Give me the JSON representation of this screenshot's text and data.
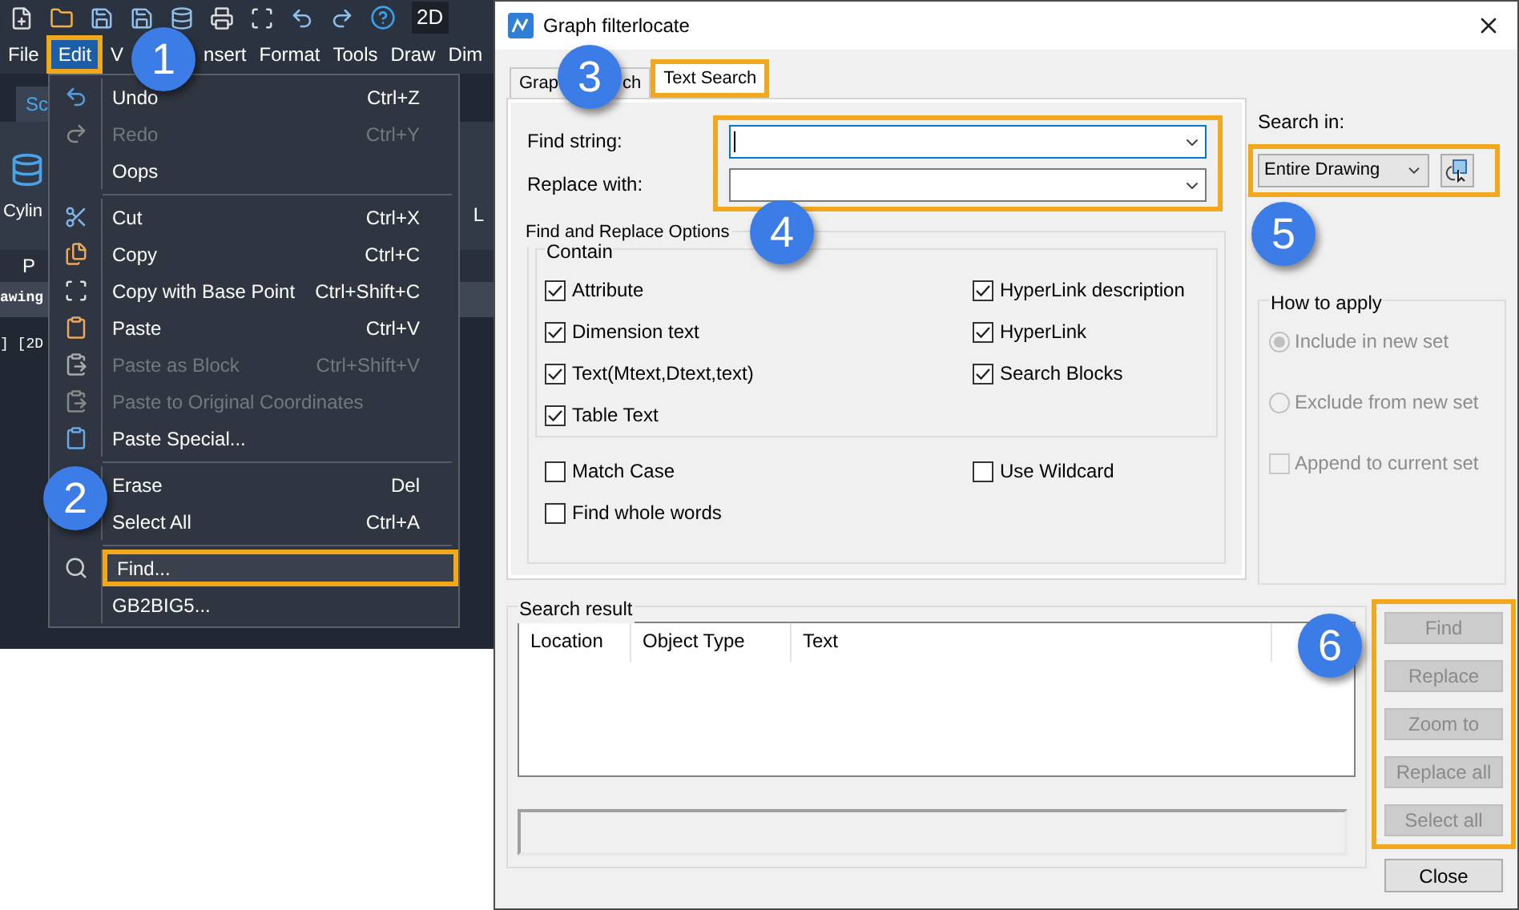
{
  "app": {
    "toolbar_label": "2D",
    "menu": [
      {
        "label": "File",
        "selected": false
      },
      {
        "label": "Edit",
        "selected": true
      },
      {
        "label": "V",
        "selected": false,
        "callout": "1"
      },
      {
        "label": "nsert",
        "selected": false
      },
      {
        "label": "Format",
        "selected": false
      },
      {
        "label": "Tools",
        "selected": false
      },
      {
        "label": "Draw",
        "selected": false
      },
      {
        "label": "Dim",
        "selected": false
      }
    ],
    "ribbon_tab": "Sc",
    "ribbon_button": "Cylin",
    "ribbon_tail": "L",
    "panel_label": "P",
    "drawing_tab": "awing",
    "viewport_label": "] [2D"
  },
  "edit_menu": [
    {
      "kind": "item",
      "label": "Undo",
      "shortcut": "Ctrl+Z",
      "disabled": false,
      "highlighted": false
    },
    {
      "kind": "item",
      "label": "Redo",
      "shortcut": "Ctrl+Y",
      "disabled": true,
      "highlighted": false
    },
    {
      "kind": "item",
      "label": "Oops",
      "disabled": false,
      "highlighted": false
    },
    {
      "kind": "separator"
    },
    {
      "kind": "item",
      "label": "Cut",
      "shortcut": "Ctrl+X",
      "disabled": false,
      "highlighted": false
    },
    {
      "kind": "item",
      "label": "Copy",
      "shortcut": "Ctrl+C",
      "disabled": false,
      "highlighted": false
    },
    {
      "kind": "item",
      "label": "Copy with Base Point",
      "shortcut": "Ctrl+Shift+C",
      "disabled": false,
      "highlighted": false
    },
    {
      "kind": "item",
      "label": "Paste",
      "shortcut": "Ctrl+V",
      "disabled": false,
      "highlighted": false
    },
    {
      "kind": "item",
      "label": "Paste as Block",
      "shortcut": "Ctrl+Shift+V",
      "disabled": true,
      "highlighted": false
    },
    {
      "kind": "item",
      "label": "Paste to Original Coordinates",
      "disabled": true,
      "highlighted": false
    },
    {
      "kind": "item",
      "label": "Paste Special...",
      "disabled": false,
      "highlighted": false
    },
    {
      "kind": "separator"
    },
    {
      "kind": "item",
      "label": "Erase",
      "shortcut": "Del",
      "disabled": false,
      "highlighted": false,
      "callout": "2"
    },
    {
      "kind": "item",
      "label": "Select All",
      "shortcut": "Ctrl+A",
      "disabled": false,
      "highlighted": false
    },
    {
      "kind": "separator"
    },
    {
      "kind": "item",
      "label": "Find...",
      "disabled": false,
      "highlighted": true
    },
    {
      "kind": "item",
      "label": "GB2BIG5...",
      "disabled": false,
      "highlighted": false
    }
  ],
  "dialog": {
    "title": "Graph filterlocate",
    "tabs": [
      {
        "label": "Grap",
        "label_tail": "ch",
        "selected": false,
        "callout": "3"
      },
      {
        "label": "Text Search",
        "selected": true
      }
    ],
    "find_label": "Find string:",
    "replace_label": "Replace with:",
    "options_title": "Find and Replace Options",
    "options_callout": "4",
    "contain_title": "Contain",
    "contain_left": [
      {
        "label": "Attribute",
        "checked": true
      },
      {
        "label": "Dimension text",
        "checked": true
      },
      {
        "label": "Text(Mtext,Dtext,text)",
        "checked": true
      },
      {
        "label": "Table Text",
        "checked": true
      }
    ],
    "contain_right": [
      {
        "label": "HyperLink description",
        "checked": true
      },
      {
        "label": "HyperLink",
        "checked": true
      },
      {
        "label": "Search Blocks",
        "checked": true
      }
    ],
    "other_left": [
      {
        "label": "Match Case",
        "checked": false
      },
      {
        "label": "Find whole words",
        "checked": false
      }
    ],
    "other_right": [
      {
        "label": "Use Wildcard",
        "checked": false
      }
    ],
    "search_in_label": "Search in:",
    "search_in_value": "Entire Drawing",
    "search_in_callout": "5",
    "how_to_apply": {
      "title": "How to apply",
      "options": [
        {
          "kind": "radio",
          "label": "Include in new set",
          "selected": true,
          "disabled": true
        },
        {
          "kind": "radio",
          "label": "Exclude from new set",
          "selected": false,
          "disabled": true
        },
        {
          "kind": "checkbox",
          "label": "Append to current set",
          "checked": false,
          "disabled": true
        }
      ]
    },
    "search_result": {
      "title": "Search result",
      "columns": [
        "Location",
        "Object Type",
        "Text"
      ]
    },
    "actions_callout": "6",
    "action_buttons": [
      {
        "label": "Find",
        "disabled": true
      },
      {
        "label": "Replace",
        "disabled": true
      },
      {
        "label": "Zoom to",
        "disabled": true
      },
      {
        "label": "Replace all",
        "disabled": true
      },
      {
        "label": "Select all",
        "disabled": true
      }
    ],
    "close_button": "Close"
  }
}
